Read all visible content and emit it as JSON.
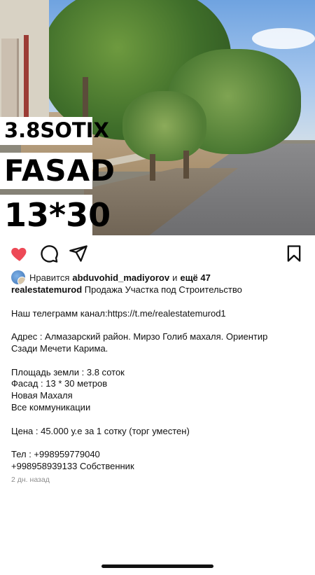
{
  "photo": {
    "overlay": [
      "3.8SOTIX",
      "FASAD",
      "13*30"
    ]
  },
  "actions": {
    "like_icon": "heart-filled-icon",
    "comment_icon": "comment-bubble-icon",
    "share_icon": "paper-plane-icon",
    "save_icon": "bookmark-icon",
    "like_color": "#ED4956"
  },
  "likes": {
    "prefix": "Нравится",
    "user": "abduvohid_madiyorov",
    "connector": "и",
    "others": "ещё 47"
  },
  "caption": {
    "username": "realestatemurod",
    "title": "Продажа Участка под Строительство",
    "lines": [
      "",
      "Наш телеграмм канал:https://t.me/realestatemurod1",
      "",
      "Адрес : Алмазарский район. Мирзо Голиб махаля. Ориентир",
      "Сзади Мечети Карима.",
      "",
      "Площадь земли : 3.8 соток",
      "Фасад : 13 * 30 метров",
      "Новая Махаля",
      "Все коммуникации",
      "",
      "Цена : 45.000 у.е за 1 сотку (торг уместен)",
      "",
      "Тел : +998959779040",
      "+998958939133 Собственник"
    ]
  },
  "timestamp": "2 дн. назад"
}
